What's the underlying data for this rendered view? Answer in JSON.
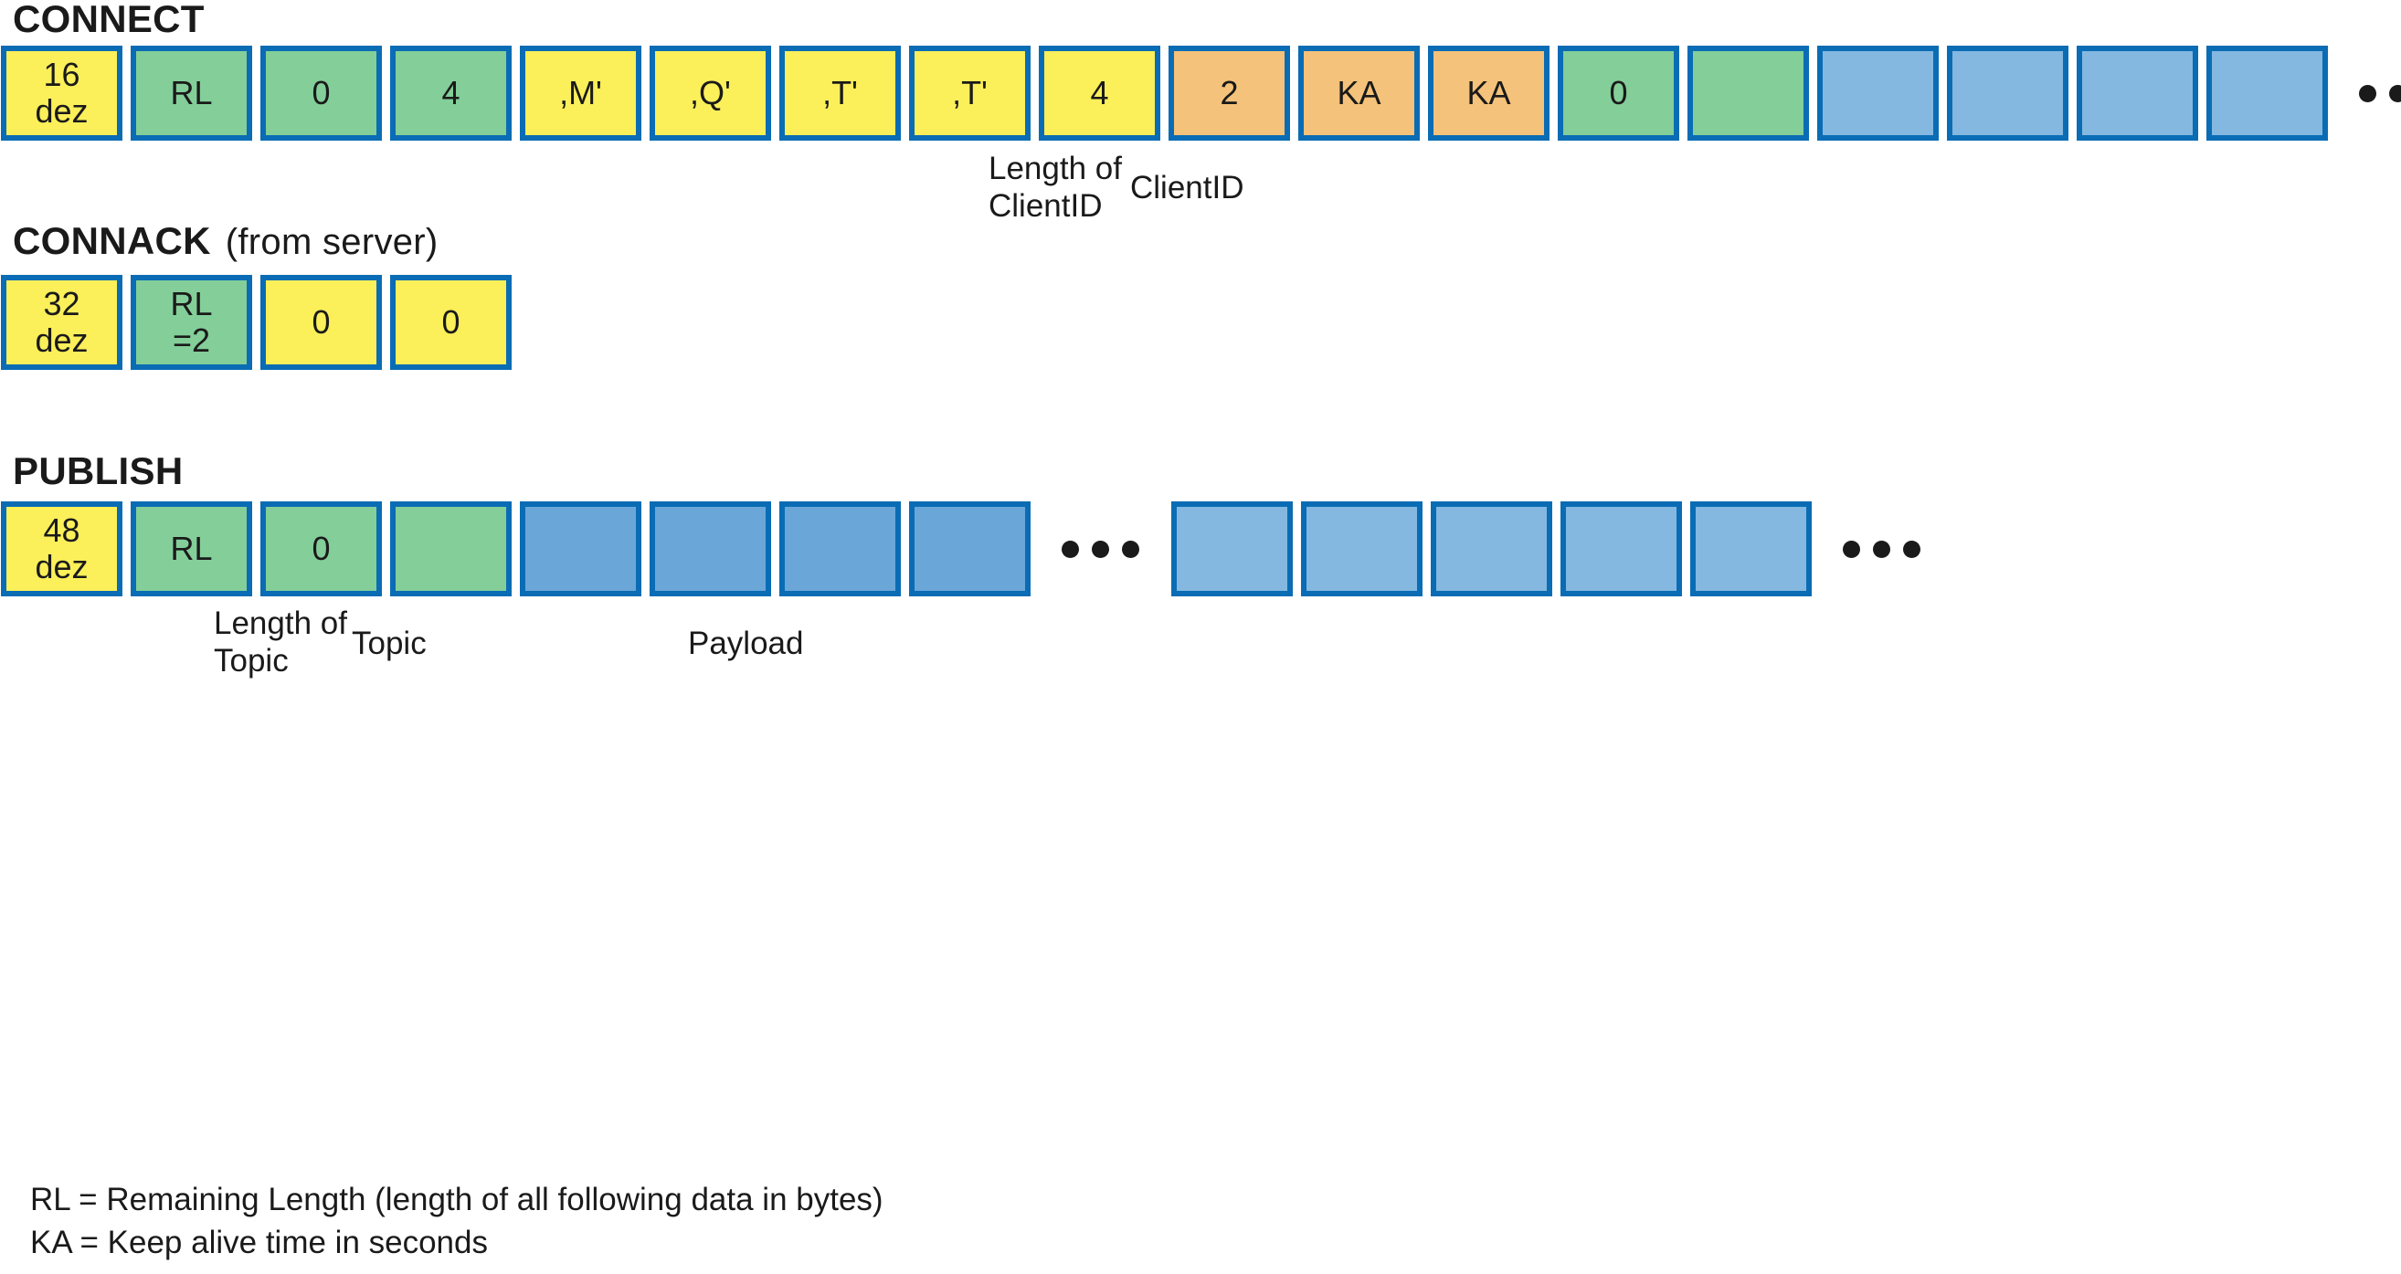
{
  "colors": {
    "border": "#0a6cb4",
    "yellow": "#fbef5a",
    "green": "#83ce99",
    "orange": "#f4c27a",
    "blue_payload": "#84b8e0",
    "blue_topic": "#6aa7d8",
    "text": "#1a1a1a",
    "background": "#ffffff"
  },
  "sections": {
    "connect": {
      "title": "CONNECT",
      "subtitle": "",
      "bytes": [
        {
          "lines": [
            "16",
            "dez"
          ],
          "color": "yellow"
        },
        {
          "lines": [
            "RL"
          ],
          "color": "green"
        },
        {
          "lines": [
            "0"
          ],
          "color": "green"
        },
        {
          "lines": [
            "4"
          ],
          "color": "green"
        },
        {
          "lines": [
            ",M'"
          ],
          "color": "yellow"
        },
        {
          "lines": [
            ",Q'"
          ],
          "color": "yellow"
        },
        {
          "lines": [
            ",T'"
          ],
          "color": "yellow"
        },
        {
          "lines": [
            ",T'"
          ],
          "color": "yellow"
        },
        {
          "lines": [
            "4"
          ],
          "color": "yellow"
        },
        {
          "lines": [
            "2"
          ],
          "color": "orange"
        },
        {
          "lines": [
            "KA"
          ],
          "color": "orange"
        },
        {
          "lines": [
            "KA"
          ],
          "color": "orange"
        },
        {
          "lines": [
            "0"
          ],
          "color": "green"
        },
        {
          "lines": [
            ""
          ],
          "color": "green"
        },
        {
          "lines": [
            ""
          ],
          "color": "blue_payload"
        },
        {
          "lines": [
            ""
          ],
          "color": "blue_payload"
        },
        {
          "lines": [
            ""
          ],
          "color": "blue_payload"
        },
        {
          "lines": [
            ""
          ],
          "color": "blue_payload"
        }
      ],
      "trailing_ellipsis": "• • •",
      "captions": [
        {
          "text": "Length of\nClientID"
        },
        {
          "text": "ClientID"
        }
      ]
    },
    "connack": {
      "title": "CONNACK",
      "subtitle": "(from server)",
      "bytes": [
        {
          "lines": [
            "32",
            "dez"
          ],
          "color": "yellow"
        },
        {
          "lines": [
            "RL",
            "=2"
          ],
          "color": "green"
        },
        {
          "lines": [
            "0"
          ],
          "color": "yellow"
        },
        {
          "lines": [
            "0"
          ],
          "color": "yellow"
        }
      ],
      "captions": []
    },
    "publish": {
      "title": "PUBLISH",
      "subtitle": "",
      "bytes": [
        {
          "lines": [
            "48",
            "dez"
          ],
          "color": "yellow"
        },
        {
          "lines": [
            "RL"
          ],
          "color": "green"
        },
        {
          "lines": [
            "0"
          ],
          "color": "green"
        },
        {
          "lines": [
            ""
          ],
          "color": "green"
        },
        {
          "lines": [
            ""
          ],
          "color": "blue_topic"
        },
        {
          "lines": [
            ""
          ],
          "color": "blue_topic"
        },
        {
          "lines": [
            ""
          ],
          "color": "blue_topic"
        },
        {
          "lines": [
            ""
          ],
          "color": "blue_topic"
        },
        {
          "ellipsis": true
        },
        {
          "lines": [
            ""
          ],
          "color": "blue_payload"
        },
        {
          "lines": [
            ""
          ],
          "color": "blue_payload"
        },
        {
          "lines": [
            ""
          ],
          "color": "blue_payload"
        },
        {
          "lines": [
            ""
          ],
          "color": "blue_payload"
        },
        {
          "lines": [
            ""
          ],
          "color": "blue_payload"
        },
        {
          "ellipsis": true
        }
      ],
      "captions": [
        {
          "text": "Length of\nTopic"
        },
        {
          "text": "Topic"
        },
        {
          "text": "Payload"
        }
      ]
    }
  },
  "legend": {
    "line1": "RL = Remaining Length (length of all following data in bytes)",
    "line2": "KA = Keep alive time in seconds"
  }
}
